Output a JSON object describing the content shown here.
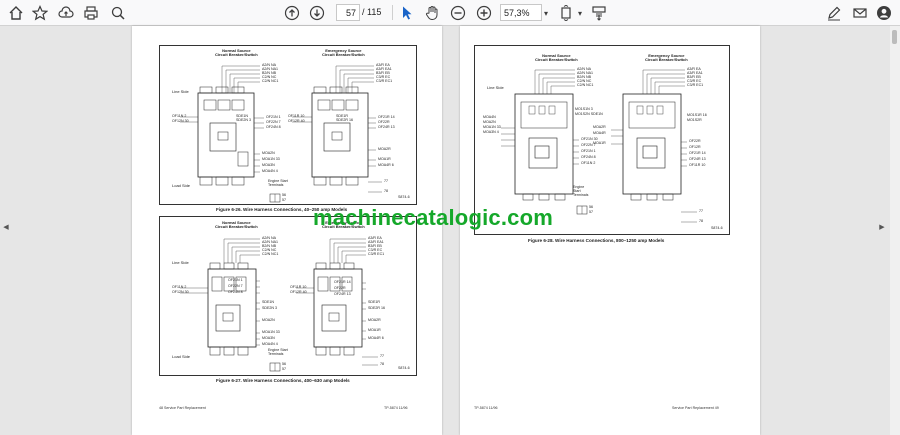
{
  "toolbar": {
    "current_page": "57",
    "total_pages": "/ 115",
    "zoom": "57,3%"
  },
  "colors": {
    "watermark": "#15a82a",
    "toolbar_bg": "#f9f9fa",
    "canvas_bg": "#e6e6e6"
  },
  "watermark": "machinecatalogic.com",
  "left_page": {
    "fig26": {
      "normal_title": "Normal Source\nCircuit Breaker/Switch",
      "emergency_title": "Emergency Source\nCircuit Breaker/Switch",
      "normal_top": [
        "A2/N NA",
        "A2/N NA1",
        "B2/N NB",
        "C2/N NC",
        "C2/N NC1"
      ],
      "emergency_top": [
        "A3/R EA",
        "A3/R EA1",
        "B3/R EB",
        "C3/R EC",
        "C3/R EC1"
      ],
      "line_side": "Line Side",
      "load_side": "Load Side",
      "left_of": [
        "OF11N 2",
        "OF12N 30"
      ],
      "right_of_n": [
        "SDE1N",
        "SDE2N 3"
      ],
      "mid_n": [
        "OF21N 1",
        "OF22N 7",
        "OF24N 8"
      ],
      "lower_n": [
        "MOA2N",
        "MOA1N 33",
        "MOA3N",
        "MOA4N 4"
      ],
      "left_of_r": [
        "OF11R 10",
        "OF12R 40"
      ],
      "right_of_r_top": [
        "SDE1R",
        "SDE2R 16"
      ],
      "mid_r": [
        "OF21R 14",
        "OF22R",
        "OF24R 13"
      ],
      "lower_r": [
        "MOA2R",
        "MOA1R",
        "MOA4R 6"
      ],
      "engine": "Engine Start\nTerminals",
      "engine_nums": [
        "56",
        "57"
      ],
      "t_nums": [
        "77",
        "78"
      ],
      "code": "S874-6",
      "caption": "Figure 6-26.  Wire Harness Connections, 40–250 amp Models"
    },
    "fig27": {
      "normal_title": "Normal Source\nCircuit Breaker/Switch",
      "emergency_title": "Emergency Source\nCircuit Breaker/Switch",
      "normal_top": [
        "A2/N NA",
        "A2/N NA1",
        "B2/N NB",
        "C2/N NC",
        "C2/N NC1"
      ],
      "emergency_top": [
        "A3/R EA",
        "A3/R EA1",
        "B3/R EB",
        "C3/R EC",
        "C3/R EC1"
      ],
      "line_side": "Line Side",
      "load_side": "Load Side",
      "left_of": [
        "OF11N 2",
        "OF12N 30"
      ],
      "mid_n": [
        "OF21N 1",
        "OF22N 7",
        "OF24N 8"
      ],
      "sde_n": [
        "SDE1N",
        "SDE2N 3"
      ],
      "lower_n": [
        "MOA2N",
        "MOA1N 33",
        "MOA3N",
        "MOA4N 4"
      ],
      "left_of_r": [
        "OF11R 10",
        "OF12R 40"
      ],
      "mid_r": [
        "OF21R 14",
        "OF22R",
        "OF24R 13"
      ],
      "sde_r": [
        "SDE1R",
        "SDE2R 16"
      ],
      "lower_r": [
        "MOA2R",
        "MOA1R",
        "MOA4R 6"
      ],
      "engine": "Engine Start\nTerminals",
      "engine_nums": [
        "56",
        "57"
      ],
      "t_nums": [
        "77",
        "78"
      ],
      "code": "S874-6",
      "caption": "Figure 6-27.  Wire Harness Connections, 400–630 amp Models"
    },
    "footer_left": "48   Service Part Replacement",
    "footer_right": "TP-5874   11/96"
  },
  "right_page": {
    "fig28": {
      "normal_title": "Normal Source\nCircuit Breaker/Switch",
      "emergency_title": "Emergency Source\nCircuit Breaker/Switch",
      "normal_top": [
        "A2/N NA",
        "A2/N NA1",
        "B2/N NB",
        "C2/N NC",
        "C2/N NC1"
      ],
      "emergency_top": [
        "A3/R EA",
        "A3/R EA1",
        "B3/R EB",
        "C3/R EC",
        "C3/R EC1"
      ],
      "line_side": "Line Side",
      "left_n": [
        "MOA4N",
        "MOA2N",
        "MOA1N 33",
        "MOA3N 4"
      ],
      "mid_n_top": [
        "MO1S1N 3",
        "MO1S2N SDE1N"
      ],
      "mid_n": [
        "OF21N 30",
        "OF22N 7",
        "OF21N 1",
        "OF24N 8",
        "OF11N 2"
      ],
      "right_r_top": [
        "MO1S1R 16",
        "MO1S2R"
      ],
      "left_r": [
        "MOA2R",
        "MOA4R",
        "MOA1R"
      ],
      "mid_r": [
        "OF22R",
        "OF12R",
        "OF21R 14",
        "OF24R 13",
        "OF11R 10"
      ],
      "engine": "Engine\nStart\nTerminals",
      "engine_nums": [
        "56",
        "57"
      ],
      "t_nums": [
        "77",
        "78"
      ],
      "code": "S874-6",
      "caption": "Figure 6-28.  Wire Harness Connections, 800–1250 amp Models"
    },
    "footer_left": "TP-5874   11/96",
    "footer_right": "Service Part Replacement   49"
  }
}
